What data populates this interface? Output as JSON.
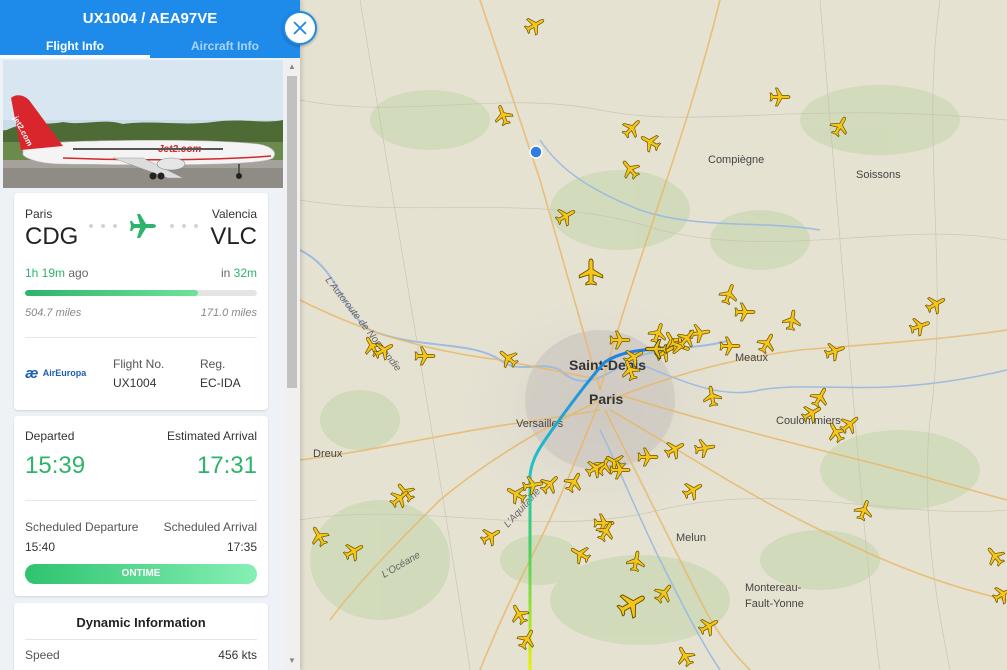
{
  "panel": {
    "title": "UX1004 / AEA97VE",
    "tabs": [
      {
        "label": "Flight Info",
        "active": true
      },
      {
        "label": "Aircraft Info",
        "active": false
      }
    ],
    "photo": {
      "livery_text": "Jet2.com",
      "tail_text": "jet2.com"
    }
  },
  "route": {
    "origin_city": "Paris",
    "origin_code": "CDG",
    "dest_city": "Valencia",
    "dest_code": "VLC",
    "elapsed_value": "1h 19m",
    "elapsed_suffix": "ago",
    "remaining_prefix": "in",
    "remaining_value": "32m",
    "progress_fraction": 0.747,
    "distance_flown": "504.7 miles",
    "distance_remaining": "171.0 miles",
    "airline_name": "AirEuropa",
    "flight_no_label": "Flight No.",
    "flight_no": "UX1004",
    "reg_label": "Reg.",
    "reg": "EC-IDA"
  },
  "times": {
    "departed_label": "Departed",
    "departed": "15:39",
    "est_arrival_label": "Estimated Arrival",
    "est_arrival": "17:31",
    "sched_dep_label": "Scheduled Departure",
    "sched_dep": "15:40",
    "sched_arr_label": "Scheduled Arrival",
    "sched_arr": "17:35",
    "status": "ONTIME"
  },
  "dynamic": {
    "title": "Dynamic Information",
    "speed_label": "Speed",
    "speed": "456 kts"
  },
  "map": {
    "places": [
      "Compiègne",
      "Soissons",
      "Saint-Denis",
      "Paris",
      "Meaux",
      "Versailles",
      "Coulommiers",
      "Dreux",
      "Melun",
      "Montereau-Fault-Yonne"
    ],
    "roads": [
      "L'Autoroute de Normandie",
      "L'Aquitaine",
      "L'Océane"
    ]
  },
  "colors": {
    "header": "#1e8bea",
    "accent_green": "#2db36b",
    "aircraft_yellow": "#f5c518",
    "route_start": "#1e7ee8",
    "route_end": "#e8f000"
  }
}
